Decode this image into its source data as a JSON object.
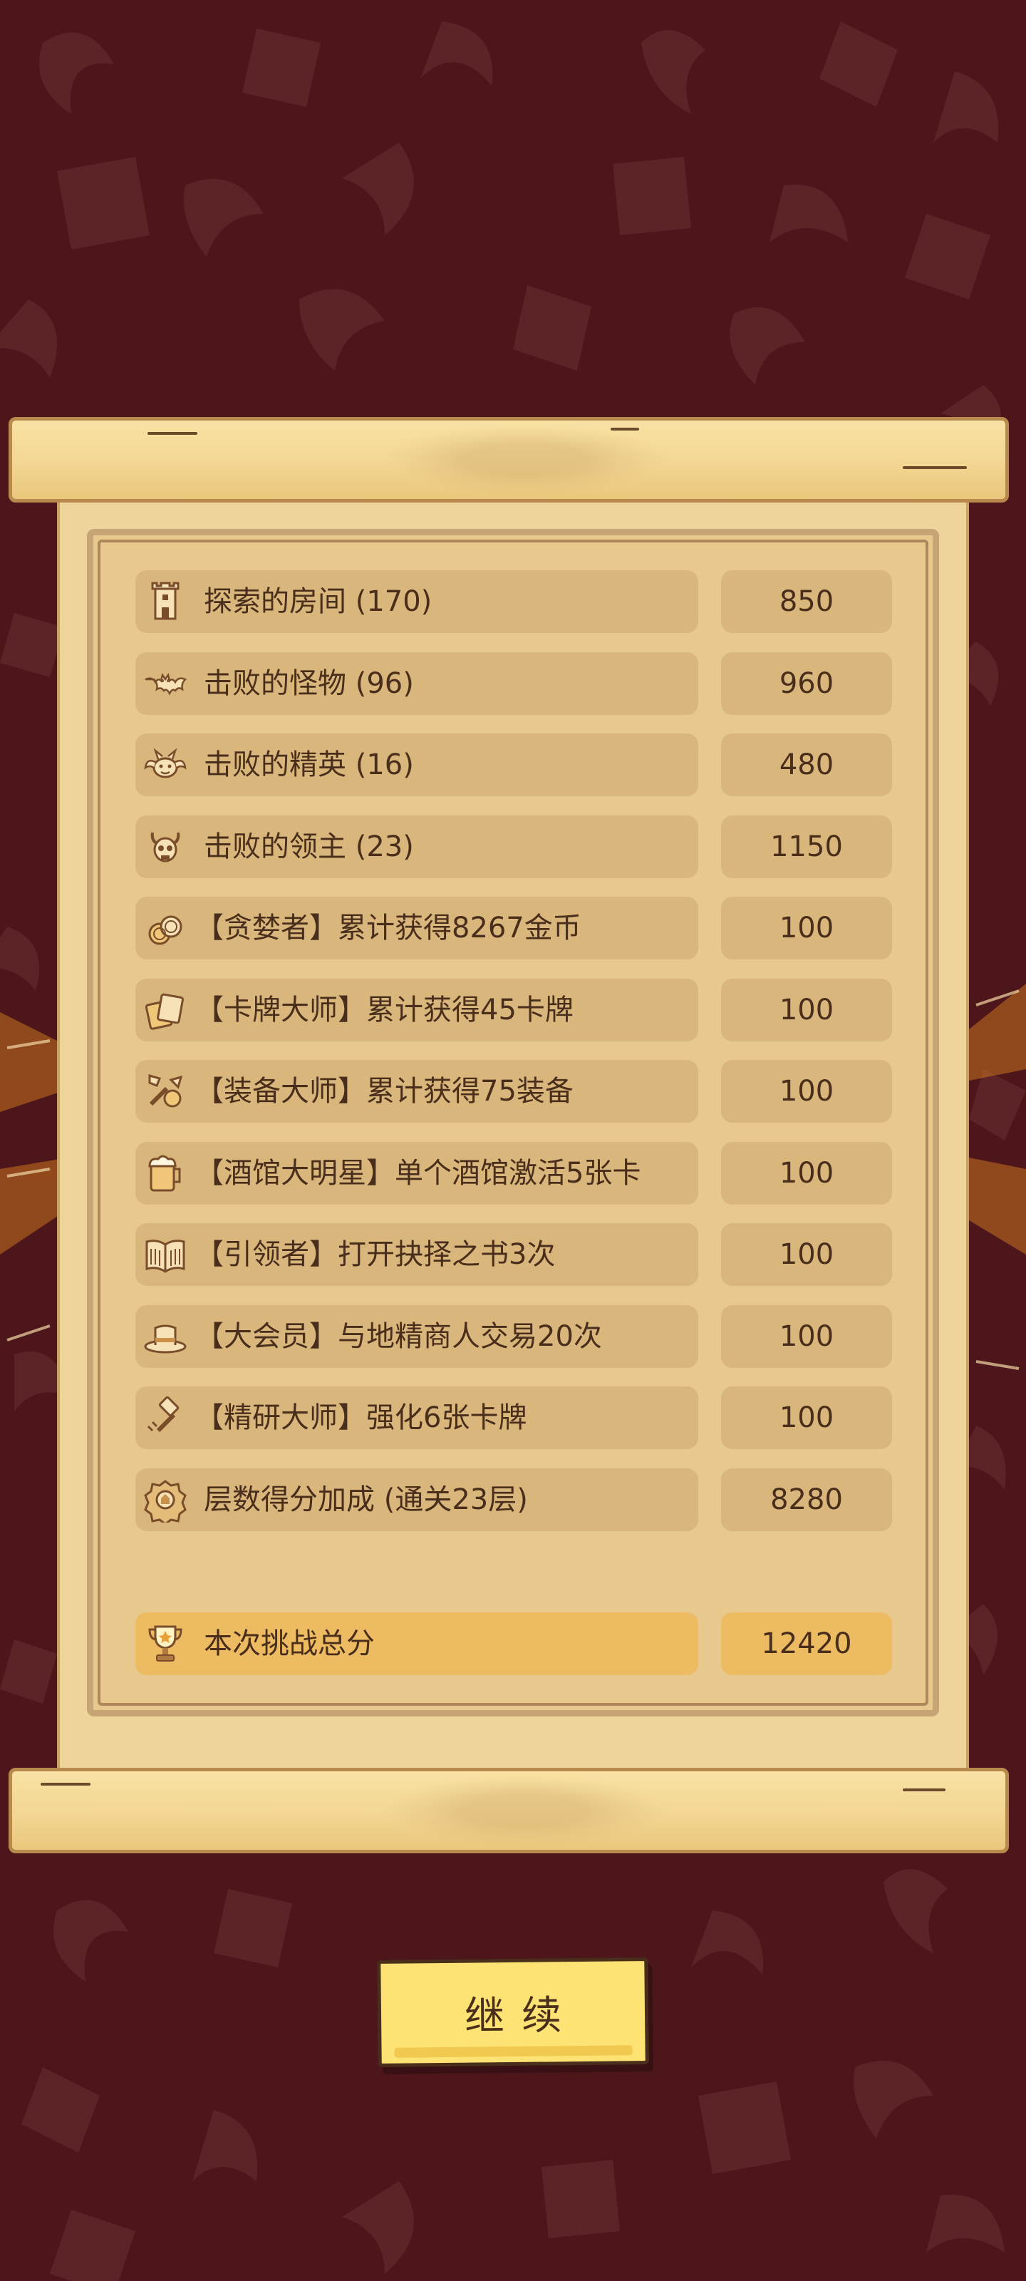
{
  "colors": {
    "background": "#4d161a",
    "parchment": "#eed49a",
    "row_fill": "#d9b77c",
    "total_fill": "#ecbb62",
    "text": "#4a2e1c",
    "button": "#fde373"
  },
  "rows": [
    {
      "icon": "castle-tower-icon",
      "label": "探索的房间 (170)",
      "value": "850"
    },
    {
      "icon": "bat-icon",
      "label": "击败的怪物 (96)",
      "value": "960"
    },
    {
      "icon": "horned-demon-icon",
      "label": "击败的精英 (16)",
      "value": "480"
    },
    {
      "icon": "horned-skull-icon",
      "label": "击败的领主 (23)",
      "value": "1150"
    },
    {
      "icon": "coin-stack-icon",
      "label": "【贪婪者】累计获得8267金币",
      "value": "100"
    },
    {
      "icon": "cards-icon",
      "label": "【卡牌大师】累计获得45卡牌",
      "value": "100"
    },
    {
      "icon": "equipment-icon",
      "label": "【装备大师】累计获得75装备",
      "value": "100"
    },
    {
      "icon": "beer-mug-icon",
      "label": "【酒馆大明星】单个酒馆激活5张卡",
      "value": "100"
    },
    {
      "icon": "open-book-icon",
      "label": "【引领者】打开抉择之书3次",
      "value": "100"
    },
    {
      "icon": "top-hat-icon",
      "label": "【大会员】与地精商人交易20次",
      "value": "100"
    },
    {
      "icon": "hammer-icon",
      "label": "【精研大师】强化6张卡牌",
      "value": "100"
    },
    {
      "icon": "floor-badge-icon",
      "label": "层数得分加成 (通关23层)",
      "value": "8280"
    }
  ],
  "total": {
    "icon": "trophy-icon",
    "label": "本次挑战总分",
    "value": "12420"
  },
  "continue_button": {
    "label": "继续"
  }
}
